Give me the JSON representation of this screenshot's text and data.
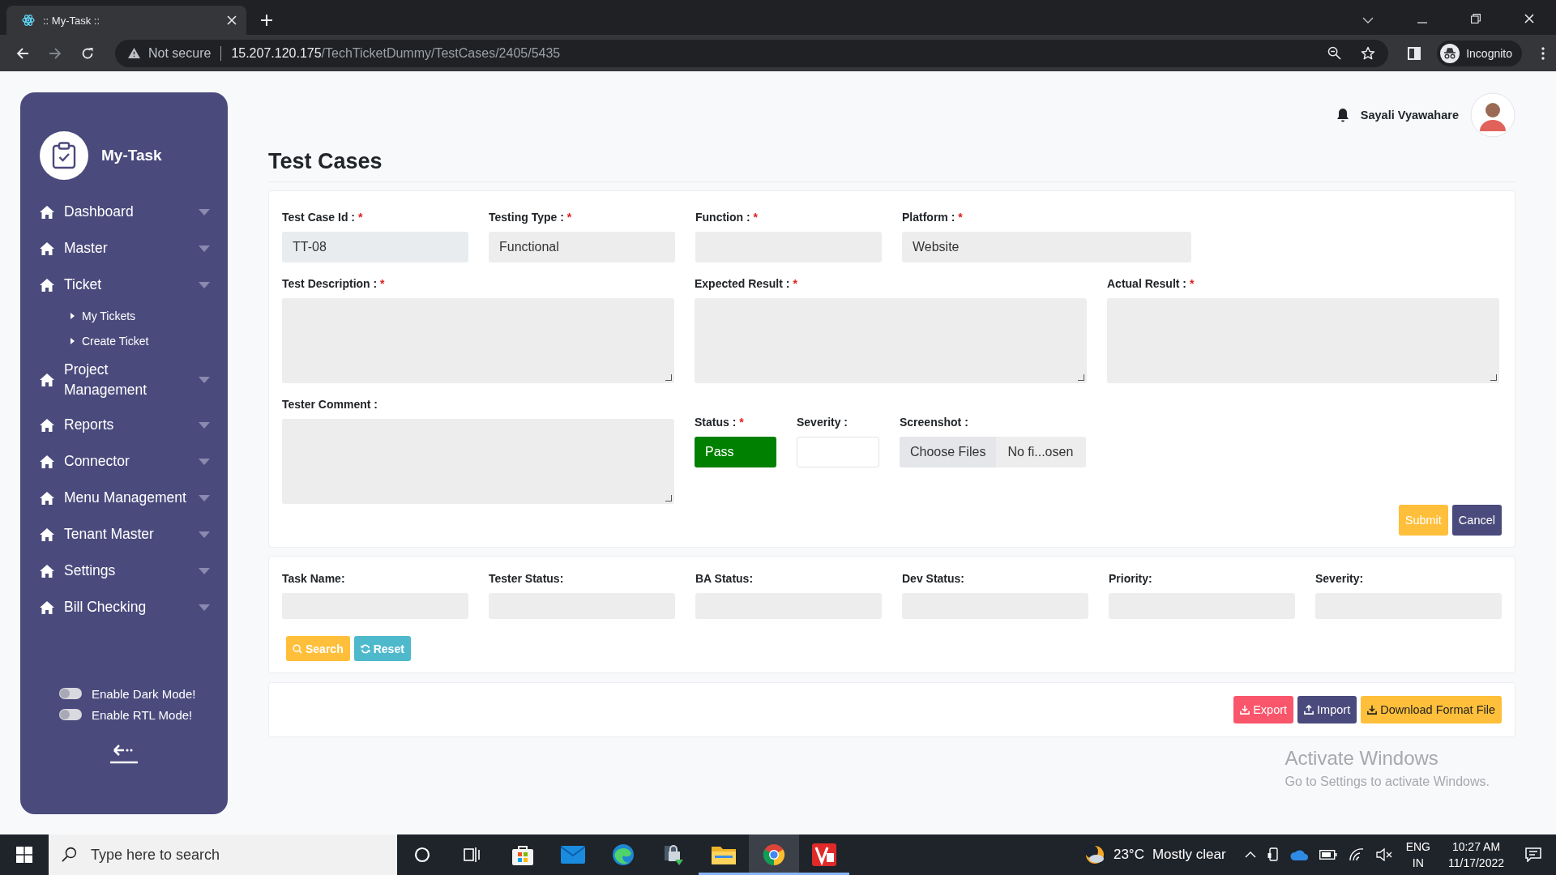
{
  "browser": {
    "tab_title": ":: My-Task ::",
    "security": "Not secure",
    "url_host": "15.207.120.175",
    "url_path": "/TechTicketDummy/TestCases/2405/5435",
    "profile": "Incognito"
  },
  "sidebar": {
    "brand": "My-Task",
    "items": [
      {
        "label": "Dashboard"
      },
      {
        "label": "Master"
      },
      {
        "label": "Ticket",
        "children": [
          {
            "label": "My Tickets"
          },
          {
            "label": "Create Ticket"
          }
        ]
      },
      {
        "label": "Project Management"
      },
      {
        "label": "Reports"
      },
      {
        "label": "Connector"
      },
      {
        "label": "Menu Management"
      },
      {
        "label": "Tenant Master"
      },
      {
        "label": "Settings"
      },
      {
        "label": "Bill Checking"
      }
    ],
    "toggles": [
      {
        "label": "Enable Dark Mode!",
        "on": false
      },
      {
        "label": "Enable RTL Mode!",
        "on": false
      }
    ]
  },
  "header": {
    "user_name": "Sayali Vyawahare"
  },
  "page_title": "Test Cases",
  "form": {
    "fields": [
      {
        "kind": "readonly",
        "label": "Test Case Id :",
        "required_mark": "*",
        "value": "TT-08"
      },
      {
        "kind": "select",
        "label": "Testing Type :",
        "required_mark": "*",
        "value": "Functional"
      },
      {
        "kind": "select",
        "label": "Function :",
        "required_mark": "*"
      },
      {
        "kind": "select",
        "label": "Platform :",
        "required_mark": "*",
        "value": "Website"
      },
      {
        "kind": "textarea",
        "label": "Test Description :",
        "required_mark": "*"
      },
      {
        "kind": "textarea",
        "label": "Expected Result :",
        "required_mark": "*"
      },
      {
        "kind": "textarea",
        "label": "Actual Result :",
        "required_mark": "*"
      },
      {
        "kind": "textarea",
        "label": "Tester Comment :"
      },
      {
        "kind": "status",
        "label": "Status :",
        "required_mark": "*",
        "value": "Pass"
      },
      {
        "kind": "plain",
        "label": "Severity :"
      },
      {
        "kind": "file",
        "label": "Screenshot :",
        "button": "Choose Files",
        "value": "No fi...osen"
      }
    ],
    "buttons": [
      {
        "kind": "warning",
        "label": "Submit"
      },
      {
        "kind": "primary",
        "label": "Cancel"
      }
    ]
  },
  "filters": {
    "fields": [
      {
        "label": "Task Name:"
      },
      {
        "label": "Tester Status:"
      },
      {
        "label": "BA Status:"
      },
      {
        "label": "Dev Status:"
      },
      {
        "label": "Priority:"
      },
      {
        "label": "Severity:"
      }
    ],
    "buttons": [
      {
        "kind": "warning",
        "label": "Search"
      },
      {
        "kind": "info",
        "label": "Reset"
      }
    ]
  },
  "actions": [
    {
      "kind": "danger",
      "label": "Export"
    },
    {
      "kind": "primary",
      "label": "Import"
    },
    {
      "kind": "warning-dark",
      "label": "Download Format File"
    }
  ],
  "watermark": {
    "title": "Activate Windows",
    "text": "Go to Settings to activate Windows."
  },
  "taskbar": {
    "search_placeholder": "Type here to search",
    "apps": [
      {
        "kind": "cortana",
        "running": false,
        "selected": false
      },
      {
        "kind": "taskview",
        "running": false,
        "selected": false
      },
      {
        "kind": "store",
        "running": false,
        "selected": false
      },
      {
        "kind": "mail",
        "running": false,
        "selected": false
      },
      {
        "kind": "edge",
        "running": false,
        "selected": false
      },
      {
        "kind": "lock",
        "running": false,
        "selected": false
      },
      {
        "kind": "folder",
        "running": true,
        "selected": false
      },
      {
        "kind": "chrome",
        "running": true,
        "selected": true
      },
      {
        "kind": "v",
        "running": true,
        "selected": false
      }
    ],
    "temperature": "23°C",
    "weather": "Mostly clear",
    "lang": "ENG",
    "region": "IN",
    "time": "10:27 AM",
    "date": "11/17/2022"
  }
}
